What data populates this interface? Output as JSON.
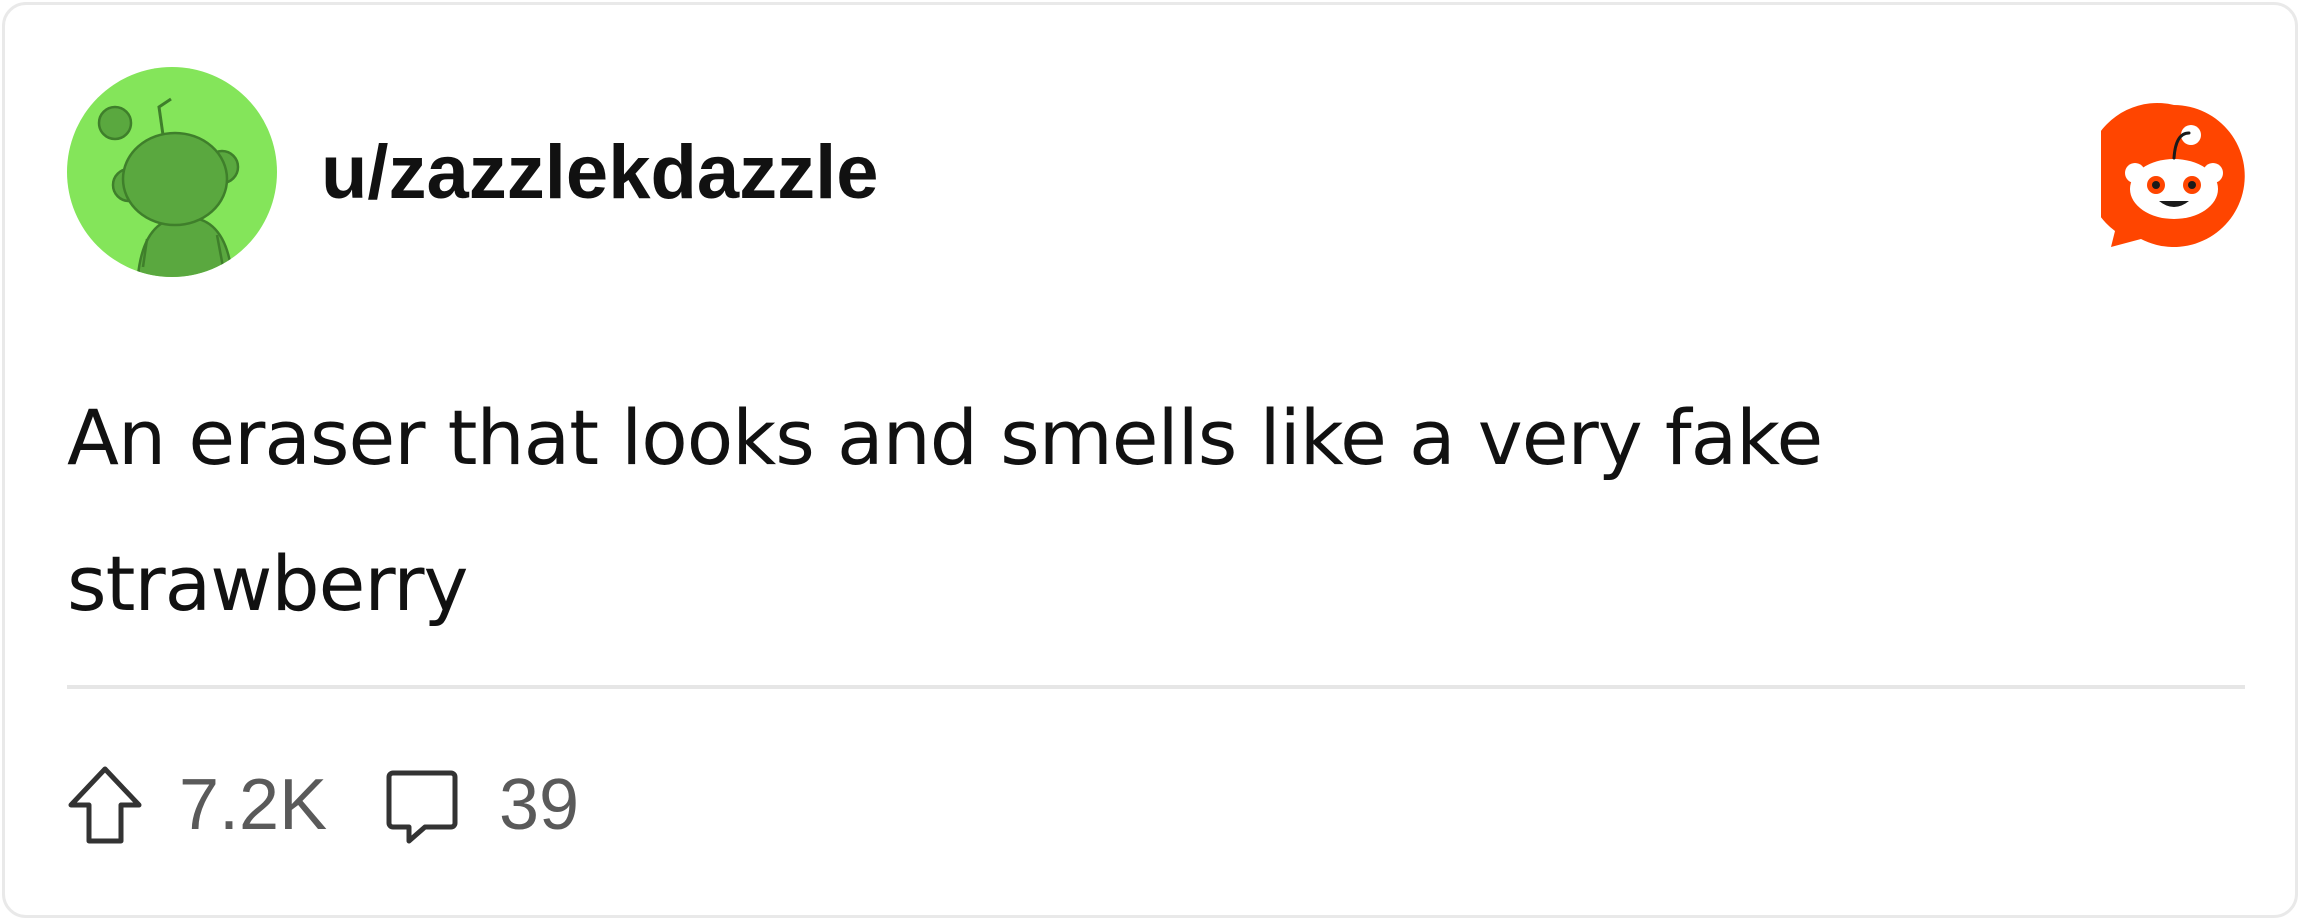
{
  "post": {
    "username": "u/zazzlekdazzle",
    "body": "An eraser that looks and smells like a very fake strawberry",
    "upvotes": "7.2K",
    "comments": "39"
  },
  "icons": {
    "avatar": "snoo-avatar-icon",
    "logo": "reddit-logo-icon",
    "upvote": "upvote-arrow-icon",
    "comment": "comment-bubble-icon"
  },
  "colors": {
    "avatar_bg": "#84e55a",
    "avatar_snoo": "#5aa83f",
    "reddit_orange": "#ff4500",
    "meta_text": "#5a5a5a"
  }
}
